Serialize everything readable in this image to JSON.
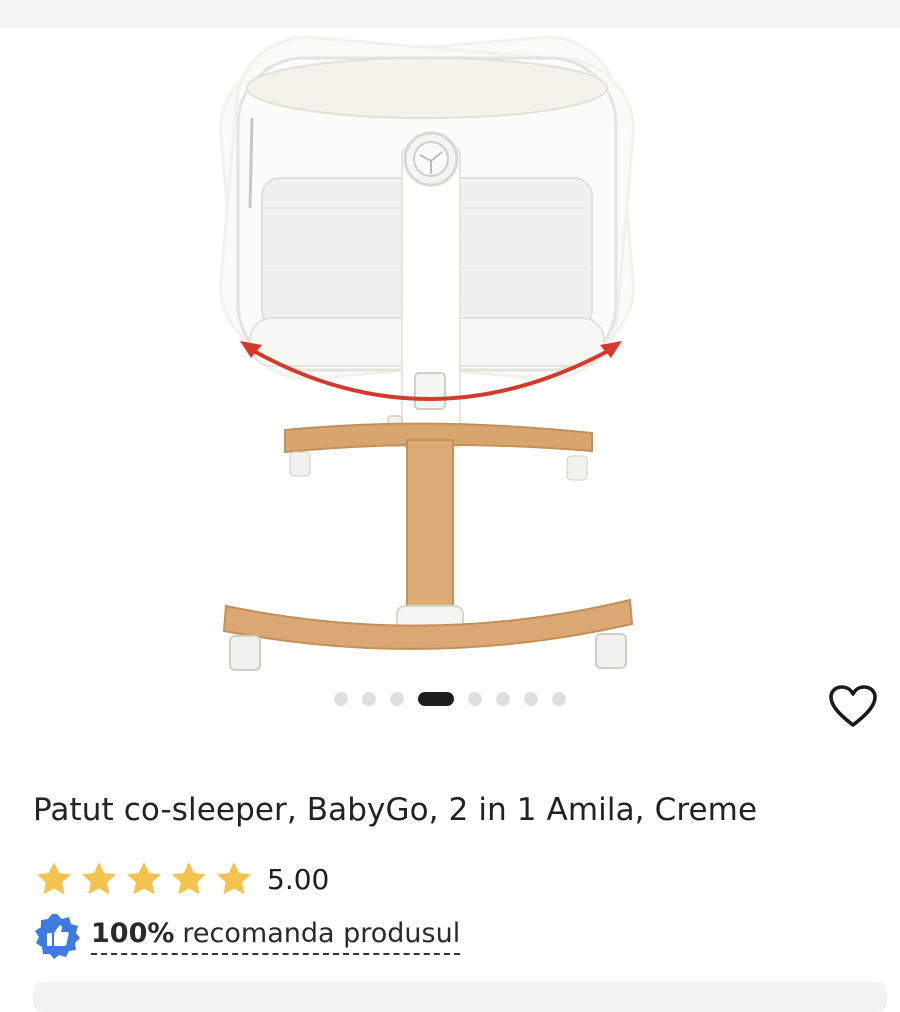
{
  "product": {
    "title": "Patut co-sleeper, BabyGo, 2 in 1 Amila, Creme",
    "rating_value": "5.00",
    "rating_stars": 5,
    "recommend_percent": "100%",
    "recommend_text": "recomanda produsul"
  },
  "gallery": {
    "image_count": 8,
    "active_index": 4
  },
  "icons": {
    "favorite": "heart-outline-icon",
    "rating": "star-icon",
    "recommend": "thumbs-up-badge-icon"
  },
  "colors": {
    "star": "#f3c34e",
    "badge": "#3d7be0",
    "active_dot": "#1e1e1e",
    "inactive_dot": "#dedede",
    "rotation_arrow": "#d33a2c"
  }
}
